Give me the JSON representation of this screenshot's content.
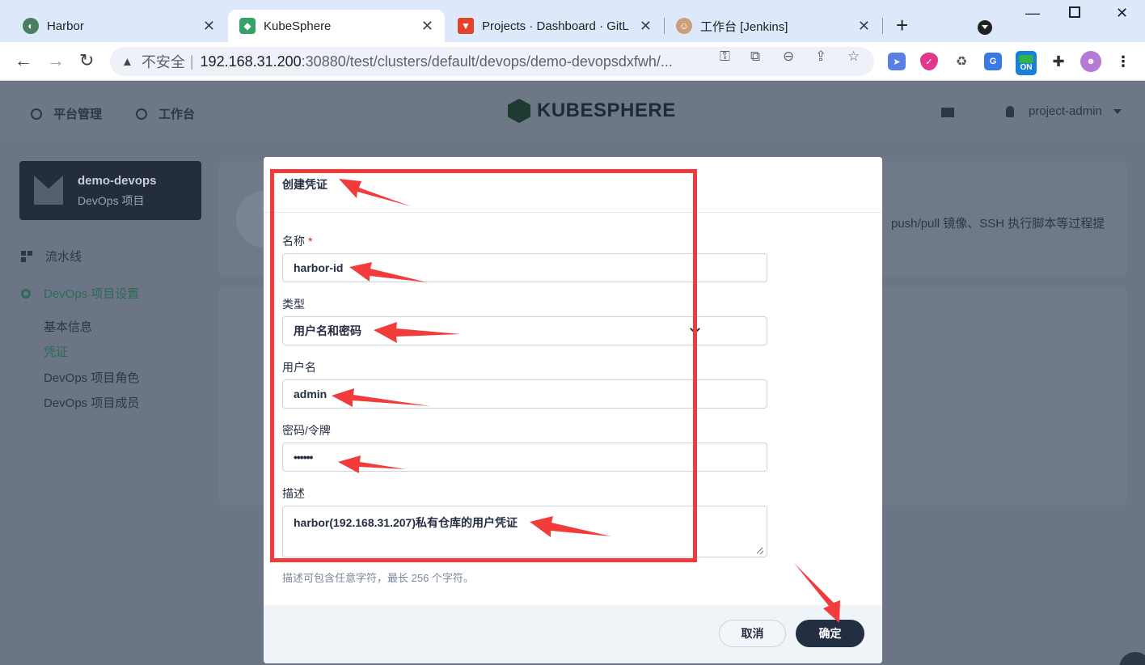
{
  "browser": {
    "tabs": [
      {
        "title": "Harbor",
        "active": false
      },
      {
        "title": "KubeSphere",
        "active": true
      },
      {
        "title": "Projects · Dashboard · GitL",
        "active": false
      },
      {
        "title": "工作台 [Jenkins]",
        "active": false
      }
    ],
    "address": {
      "security_label": "不安全",
      "host": "192.168.31.200",
      "rest": ":30880/test/clusters/default/devops/demo-devopsdxfwh/..."
    },
    "extension_on_label": "ON"
  },
  "header": {
    "nav": [
      {
        "label": "平台管理"
      },
      {
        "label": "工作台"
      }
    ],
    "logo_text": "KUBESPHERE",
    "user": "project-admin"
  },
  "sidebar": {
    "project_name": "demo-devops",
    "project_type": "DevOps 项目",
    "items": [
      {
        "label": "流水线"
      },
      {
        "label": "DevOps 项目设置"
      }
    ],
    "sub_items": [
      {
        "label": "基本信息",
        "active": false
      },
      {
        "label": "凭证",
        "active": true
      },
      {
        "label": "DevOps 项目角色",
        "active": false
      },
      {
        "label": "DevOps 项目成员",
        "active": false
      }
    ]
  },
  "background": {
    "desc_fragment": "push/pull 镜像、SSH 执行脚本等过程提"
  },
  "modal": {
    "title": "创建凭证",
    "fields": {
      "name": {
        "label": "名称",
        "required_mark": "*",
        "value": "harbor-id"
      },
      "type": {
        "label": "类型",
        "value": "用户名和密码"
      },
      "username": {
        "label": "用户名",
        "value": "admin"
      },
      "password": {
        "label": "密码/令牌",
        "value": "••••••"
      },
      "description": {
        "label": "描述",
        "value": "harbor(192.168.31.207)私有仓库的用户凭证",
        "hint": "描述可包含任意字符，最长 256 个字符。"
      }
    },
    "cancel_label": "取消",
    "ok_label": "确定"
  },
  "colors": {
    "annotation_red": "#f23c3c",
    "primary_dark": "#242e42",
    "accent_green": "#2d6b55"
  }
}
